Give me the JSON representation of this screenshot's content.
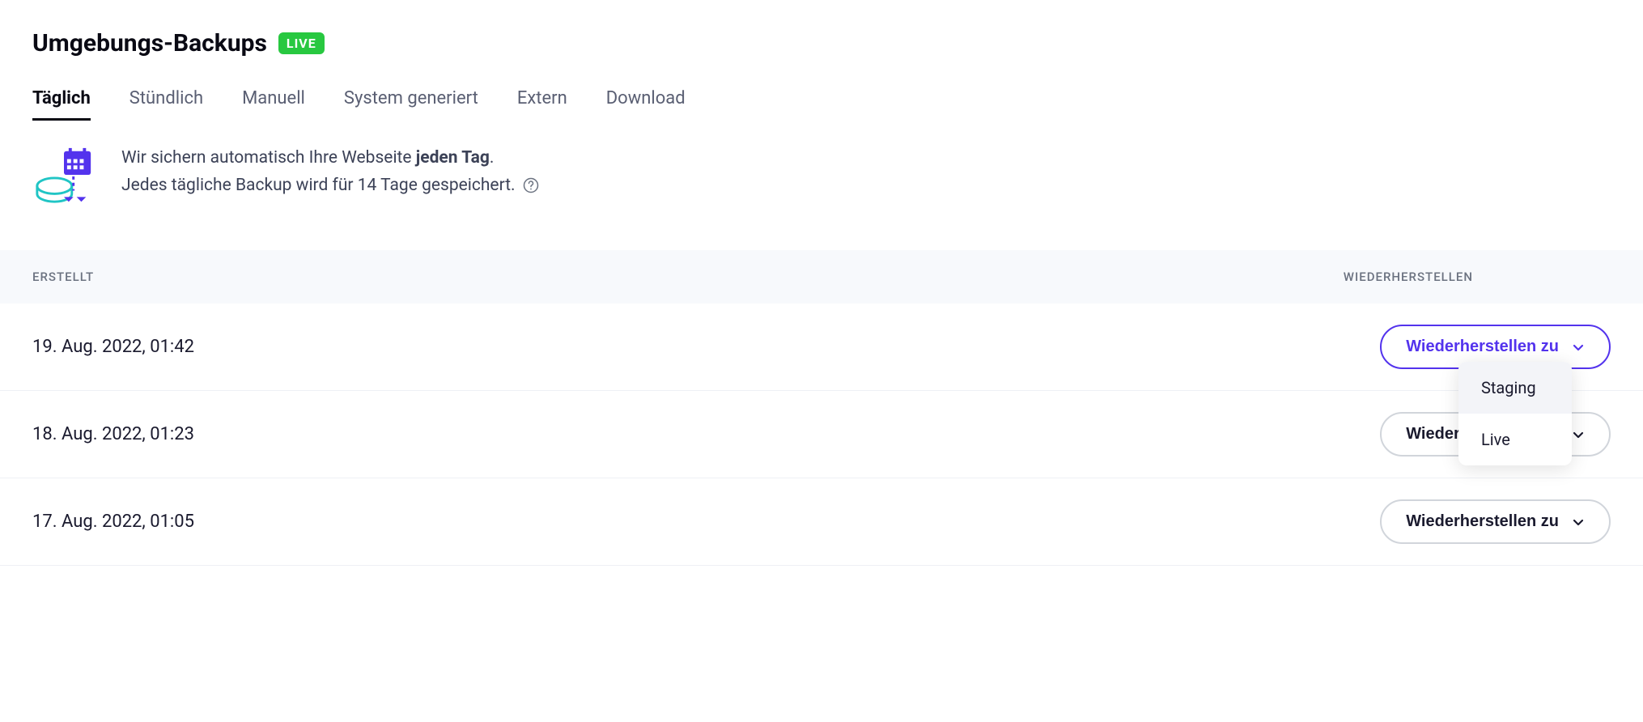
{
  "header": {
    "title": "Umgebungs-Backups",
    "badge": "LIVE"
  },
  "tabs": [
    {
      "label": "Täglich",
      "active": true
    },
    {
      "label": "Stündlich",
      "active": false
    },
    {
      "label": "Manuell",
      "active": false
    },
    {
      "label": "System generiert",
      "active": false
    },
    {
      "label": "Extern",
      "active": false
    },
    {
      "label": "Download",
      "active": false
    }
  ],
  "info": {
    "line1_prefix": "Wir sichern automatisch Ihre Webseite ",
    "line1_bold": "jeden Tag",
    "line1_suffix": ".",
    "line2": "Jedes tägliche Backup wird für 14 Tage gespeichert."
  },
  "table": {
    "col_created": "ERSTELLT",
    "col_restore": "WIEDERHERSTELLEN",
    "restore_button_label": "Wiederherstellen zu",
    "rows": [
      {
        "created": "19. Aug. 2022, 01:42",
        "primary": true,
        "open": true
      },
      {
        "created": "18. Aug. 2022, 01:23",
        "primary": false,
        "open": false
      },
      {
        "created": "17. Aug. 2022, 01:05",
        "primary": false,
        "open": false
      }
    ],
    "dropdown": {
      "options": [
        {
          "label": "Staging",
          "hover": true
        },
        {
          "label": "Live",
          "hover": false
        }
      ]
    }
  }
}
